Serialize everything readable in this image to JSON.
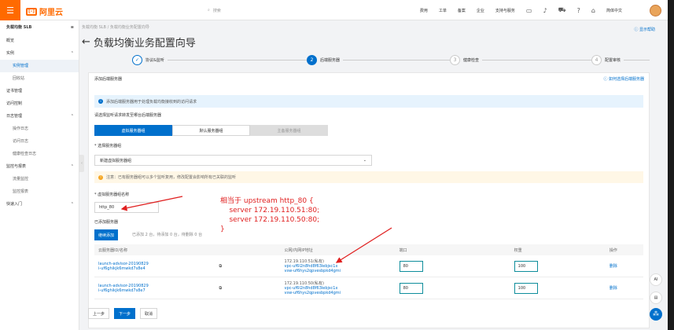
{
  "topbar": {
    "logo_text": "阿里云",
    "search_placeholder": "搜索",
    "nav": [
      "费用",
      "工单",
      "备案",
      "企业",
      "支持与服务"
    ],
    "lang": "简体中文"
  },
  "sidebar": {
    "title": "负载均衡 SLB",
    "items": [
      {
        "label": "概览",
        "level": 0
      },
      {
        "label": "实例",
        "level": 0,
        "expand": true
      },
      {
        "label": "实例管理",
        "level": 1,
        "active": true
      },
      {
        "label": "回收站",
        "level": 1
      },
      {
        "label": "证书管理",
        "level": 0
      },
      {
        "label": "访问控制",
        "level": 0
      },
      {
        "label": "日志管理",
        "level": 0,
        "expand": true
      },
      {
        "label": "操作日志",
        "level": 1
      },
      {
        "label": "访问日志",
        "level": 1
      },
      {
        "label": "健康检查日志",
        "level": 1
      },
      {
        "label": "监控与报表",
        "level": 0,
        "expand": true
      },
      {
        "label": "流量监控",
        "level": 1
      },
      {
        "label": "监控报表",
        "level": 1
      },
      {
        "label": "快速入门",
        "level": 0,
        "expand": true
      }
    ]
  },
  "breadcrumb": "负载均衡 SLB  /  负载均衡业务配置向导",
  "page_title": "负载均衡业务配置向导",
  "help_link": "显示帮助",
  "steps": [
    {
      "num": "✓",
      "label": "协议&监听",
      "state": "done"
    },
    {
      "num": "2",
      "label": "后端服务器",
      "state": "current"
    },
    {
      "num": "3",
      "label": "健康检查",
      "state": "todo"
    },
    {
      "num": "4",
      "label": "配置审核",
      "state": "todo"
    }
  ],
  "panel": {
    "title": "添加后端服务器",
    "doc_link": "如何选择后端服务器",
    "info": "添加后端服务器用于处理负载均衡接收到的访问请求",
    "choose_label": "请选择监听请求转发至哪台后端服务器",
    "tabs": [
      "虚拟服务器组",
      "默认服务器组",
      "主备服务器组"
    ],
    "group_label": "* 选择服务器组",
    "group_value": "新建虚拟服务器组",
    "warn": "注意：已有服务器组可以多个监听复用，修改配置会影响所有已关联的监听",
    "name_label": "* 虚拟服务器组名称",
    "name_value": "http_80",
    "added_label": "已添加服务器",
    "add_button": "继续添加",
    "add_hint": "已添加 2 台，待添加 0 台，待删除 0 台",
    "columns": [
      "云服务器ID/名称",
      "",
      "公网/内网IP地址",
      "端口",
      "权重",
      "操作"
    ],
    "rows": [
      {
        "name": "launch-advisor-20190829",
        "id": "i-uf6ghikjk6mwkd7s8e4",
        "ip": "172.19.110.51(私有)",
        "vpc1": "vpc-uf6l2n8hd8f63lebjsc1x",
        "vpc2": "vsw-uf6hys2qpvesbpkd4gmi",
        "port": "80",
        "weight": "100",
        "action": "删除"
      },
      {
        "name": "launch-advisor-20190829",
        "id": "i-uf6ghikjk6mwkd7s8e7",
        "ip": "172.19.110.50(私有)",
        "vpc1": "vpc-uf6l2n8hd8f63lebjsc1x",
        "vpc2": "vsw-uf6hys2qpvesbpkd4gmi",
        "port": "80",
        "weight": "100",
        "action": "删除"
      }
    ]
  },
  "footer": {
    "prev": "上一步",
    "next": "下一步",
    "cancel": "取消"
  },
  "annotation": [
    "相当于 upstream http_80 {",
    "    server 172.19.110.51:80;",
    "    server 172.19.110.50:80;",
    "}"
  ],
  "fabs": [
    "AI",
    "▤",
    "⁂"
  ],
  "colors": {
    "brand": "#ff6a00",
    "primary": "#0070cc",
    "annotation": "#e02020"
  }
}
